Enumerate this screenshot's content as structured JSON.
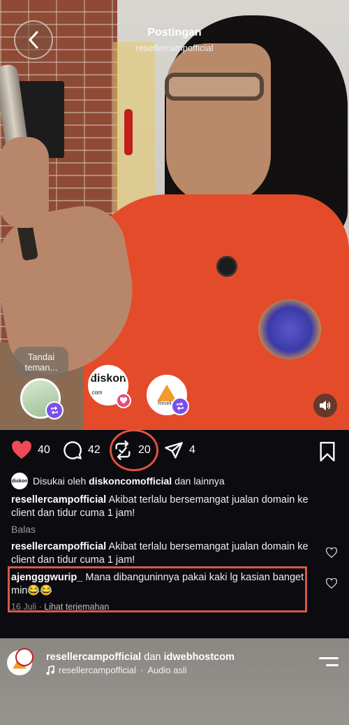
{
  "header": {
    "title": "Postingan",
    "username": "resellercampofficial"
  },
  "overlays": {
    "tag_text": "Tandai teman...",
    "avatars": [
      "diskon"
    ],
    "avatar_logo_1": "diskon",
    "avatar_logo_1_suffix": ".com",
    "avatar_logo_2": "Reseller"
  },
  "actions": {
    "likes": "40",
    "comments": "42",
    "reposts": "20",
    "shares": "4"
  },
  "liked_by": {
    "prefix": "Disukai oleh",
    "user": "diskoncomofficial",
    "suffix": "dan lainnya",
    "avatar_text": "diskon"
  },
  "caption": {
    "user": "resellercampofficial",
    "text": "Akibat terlalu bersemangat jualan domain ke client dan tidur cuma 1 jam!"
  },
  "reply_label": "Balas",
  "comments": [
    {
      "user": "resellercampofficial",
      "text": "Akibat terlalu bersemangat jualan domain ke client dan tidur cuma 1 jam!"
    },
    {
      "user": "ajengggwurip_",
      "text": "Mana dibanguninnya pakai kaki lg kasian banget min😂😂",
      "date": "16 Juli",
      "translate": "Lihat terjemahan"
    }
  ],
  "next_post": {
    "user": "resellercampofficial",
    "joiner": "dan",
    "coauthor": "idwebhostcom",
    "audio_user": "resellercampofficial",
    "audio_label": "Audio asli"
  },
  "colors": {
    "like": "#ed4956",
    "highlight": "#d45a48",
    "repost_badge": "#7a50e8"
  }
}
